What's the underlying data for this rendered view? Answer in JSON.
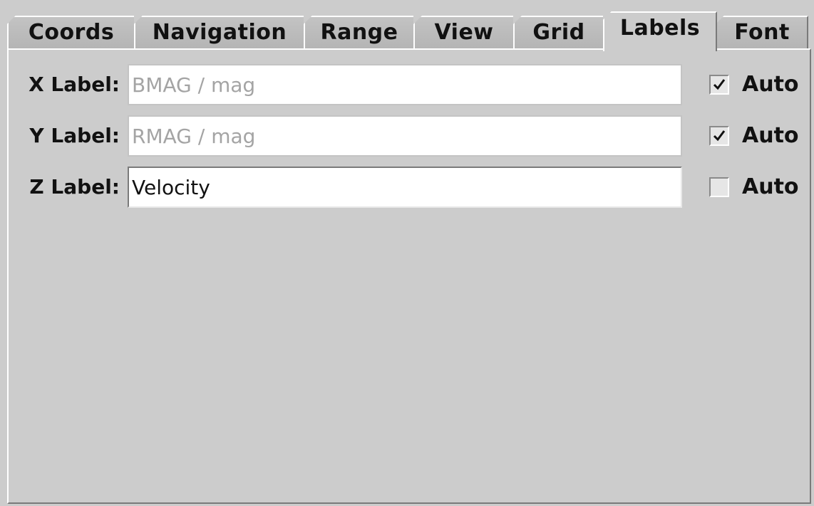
{
  "tabs": [
    {
      "label": "Coords",
      "selected": false
    },
    {
      "label": "Navigation",
      "selected": false
    },
    {
      "label": "Range",
      "selected": false
    },
    {
      "label": "View",
      "selected": false
    },
    {
      "label": "Grid",
      "selected": false
    },
    {
      "label": "Labels",
      "selected": true
    },
    {
      "label": "Font",
      "selected": false
    }
  ],
  "labels_panel": {
    "rows": [
      {
        "label": "X Label:",
        "value": "BMAG / mag",
        "enabled": false,
        "auto_label": "Auto",
        "auto_checked": true
      },
      {
        "label": "Y Label:",
        "value": "RMAG / mag",
        "enabled": false,
        "auto_label": "Auto",
        "auto_checked": true
      },
      {
        "label": "Z Label:",
        "value": "Velocity",
        "enabled": true,
        "auto_label": "Auto",
        "auto_checked": false
      }
    ]
  },
  "colors": {
    "background": "#cccccc",
    "field_background": "#ffffff",
    "disabled_text": "#a4a4a4"
  }
}
